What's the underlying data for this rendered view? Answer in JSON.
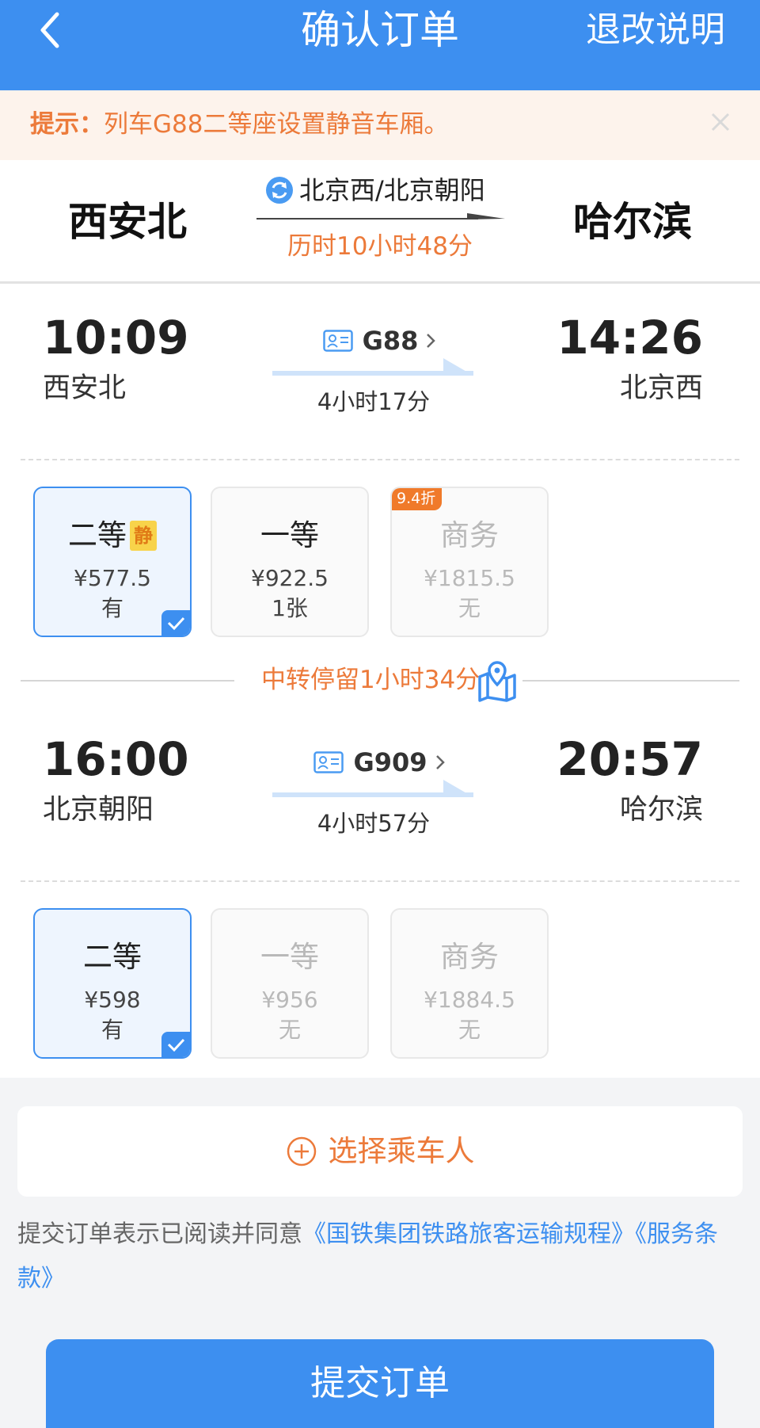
{
  "header": {
    "title": "确认订单",
    "right_link": "退改说明"
  },
  "notice": {
    "prefix": "提示：",
    "text": "列车G88二等座设置静音车厢。"
  },
  "route": {
    "from": "西安北",
    "to": "哈尔滨",
    "via": "北京西/北京朝阳",
    "duration": "历时10小时48分"
  },
  "segments": [
    {
      "depart_time": "10:09",
      "depart_station": "西安北",
      "arrive_time": "14:26",
      "arrive_station": "北京西",
      "train_no": "G88",
      "duration": "4小时17分",
      "seats": [
        {
          "class": "二等",
          "badge": "静",
          "price": "¥577.5",
          "availability": "有",
          "selected": true,
          "disabled": false
        },
        {
          "class": "一等",
          "price": "¥922.5",
          "availability": "1张",
          "selected": false,
          "disabled": false
        },
        {
          "class": "商务",
          "price": "¥1815.5",
          "availability": "无",
          "discount": "9.4折",
          "selected": false,
          "disabled": true
        }
      ]
    },
    {
      "depart_time": "16:00",
      "depart_station": "北京朝阳",
      "arrive_time": "20:57",
      "arrive_station": "哈尔滨",
      "train_no": "G909",
      "duration": "4小时57分",
      "seats": [
        {
          "class": "二等",
          "price": "¥598",
          "availability": "有",
          "selected": true,
          "disabled": false
        },
        {
          "class": "一等",
          "price": "¥956",
          "availability": "无",
          "selected": false,
          "disabled": true
        },
        {
          "class": "商务",
          "price": "¥1884.5",
          "availability": "无",
          "selected": false,
          "disabled": true
        }
      ]
    }
  ],
  "transfer": {
    "text": "中转停留1小时34分"
  },
  "passenger": {
    "label": "选择乘车人"
  },
  "agreement": {
    "text": "提交订单表示已阅读并同意",
    "link1": "《国铁集团铁路旅客运输规程》",
    "link2": "《服务条款》"
  },
  "submit": {
    "label": "提交订单"
  },
  "colors": {
    "primary": "#3d8ff0",
    "accent": "#ec7a3a",
    "notice_bg": "#fdf3ec",
    "quiet_badge": "#f8d34a",
    "discount_badge": "#f07a2a"
  },
  "icons": {
    "back": "chevron-left-icon",
    "close": "close-icon",
    "transfer": "transfer-icon",
    "train": "id-card-icon",
    "map": "map-pin-icon",
    "add": "plus-circle-icon"
  }
}
